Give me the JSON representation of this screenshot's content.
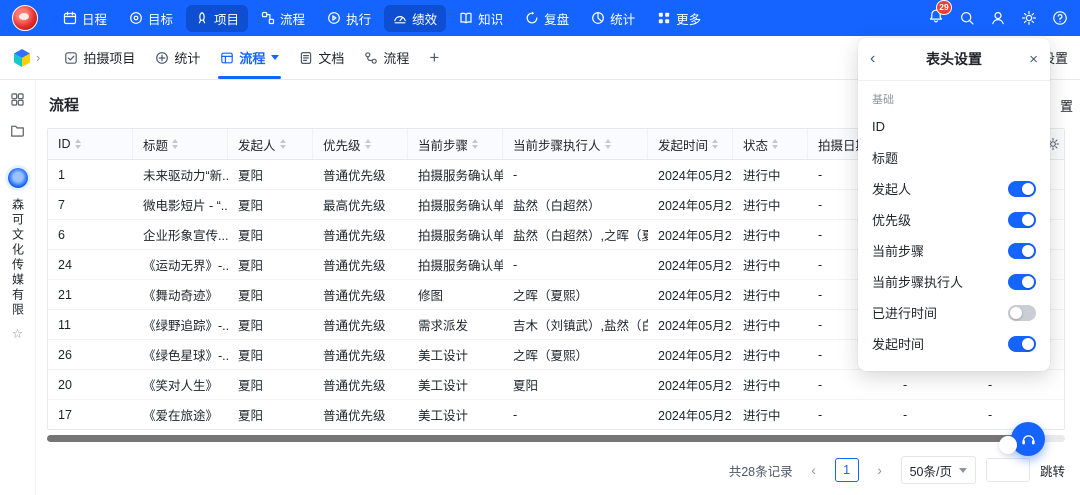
{
  "brand": {
    "accent_color": "#1664FF",
    "active_item_color": "#0E4FD1",
    "badge_color": "#F23C3C"
  },
  "topnav": {
    "items": [
      {
        "id": "schedule",
        "label": "日程",
        "icon": "calendar-icon",
        "active": false
      },
      {
        "id": "goals",
        "label": "目标",
        "icon": "target-icon",
        "active": false
      },
      {
        "id": "projects",
        "label": "项目",
        "icon": "project-icon",
        "active": true
      },
      {
        "id": "flow",
        "label": "流程",
        "icon": "flowchart-icon",
        "active": false
      },
      {
        "id": "execute",
        "label": "执行",
        "icon": "execute-icon",
        "active": false
      },
      {
        "id": "performance",
        "label": "绩效",
        "icon": "performance-icon",
        "active": true
      },
      {
        "id": "knowledge",
        "label": "知识",
        "icon": "knowledge-icon",
        "active": false
      },
      {
        "id": "review",
        "label": "复盘",
        "icon": "review-icon",
        "active": false
      },
      {
        "id": "stats",
        "label": "统计",
        "icon": "stats-icon",
        "active": false
      },
      {
        "id": "more",
        "label": "更多",
        "icon": "more-icon",
        "active": false
      }
    ],
    "notification_badge": "29"
  },
  "tabbar": {
    "tabs": [
      {
        "id": "shooting-project",
        "label": "拍摄项目",
        "icon": "check-square-icon",
        "active": false,
        "dropdown": false
      },
      {
        "id": "statistics",
        "label": "统计",
        "icon": "plus-circle-icon",
        "active": false,
        "dropdown": false
      },
      {
        "id": "flow",
        "label": "流程",
        "icon": "table-icon",
        "active": true,
        "dropdown": true
      },
      {
        "id": "docs",
        "label": "文档",
        "icon": "doc-icon",
        "active": false,
        "dropdown": false
      },
      {
        "id": "flow-2",
        "label": "流程",
        "icon": "workflow-icon",
        "active": false,
        "dropdown": false
      }
    ],
    "add_tab_label": "+",
    "right_label": "设置"
  },
  "sidebar": {
    "company_name": "森可文化传媒有限",
    "star_glyph": "☆"
  },
  "main": {
    "title": "流程",
    "toolbar_partial_label": "置",
    "table": {
      "columns": [
        {
          "label": "ID",
          "sortable": true
        },
        {
          "label": "标题",
          "sortable": true
        },
        {
          "label": "发起人",
          "sortable": true
        },
        {
          "label": "优先级",
          "sortable": true
        },
        {
          "label": "当前步骤",
          "sortable": true
        },
        {
          "label": "当前步骤执行人",
          "sortable": true
        },
        {
          "label": "发起时间",
          "sortable": true
        },
        {
          "label": "状态",
          "sortable": true
        },
        {
          "label": "拍摄日期",
          "sortable": true
        },
        {
          "label": "",
          "sortable": false
        },
        {
          "label": "",
          "sortable": false
        }
      ],
      "rows": [
        [
          "1",
          "未来驱动力“新...",
          "夏阳",
          "普通优先级",
          "拍摄服务确认单",
          "-",
          "2024年05月2...",
          "进行中",
          "-",
          "-",
          "-"
        ],
        [
          "7",
          "微电影短片 - “...",
          "夏阳",
          "最高优先级",
          "拍摄服务确认单",
          "盐然（白超然）",
          "2024年05月2...",
          "进行中",
          "-",
          "-",
          "-"
        ],
        [
          "6",
          "企业形象宣传...",
          "夏阳",
          "普通优先级",
          "拍摄服务确认单",
          "盐然（白超然）,之晖（夏熙）",
          "2024年05月2...",
          "进行中",
          "-",
          "-",
          "-"
        ],
        [
          "24",
          "《运动无界》-...",
          "夏阳",
          "普通优先级",
          "拍摄服务确认单",
          "-",
          "2024年05月2...",
          "进行中",
          "-",
          "-",
          "-"
        ],
        [
          "21",
          "《舞动奇迹》",
          "夏阳",
          "普通优先级",
          "修图",
          "之晖（夏熙）",
          "2024年05月2...",
          "进行中",
          "-",
          "-",
          "-"
        ],
        [
          "11",
          "《绿野追踪》-...",
          "夏阳",
          "普通优先级",
          "需求派发",
          "吉木（刘镇武）,盐然（白超然...",
          "2024年05月2...",
          "进行中",
          "-",
          "-",
          "-"
        ],
        [
          "26",
          "《绿色星球》-...",
          "夏阳",
          "普通优先级",
          "美工设计",
          "之晖（夏熙）",
          "2024年05月2...",
          "进行中",
          "-",
          "-",
          "-"
        ],
        [
          "20",
          "《笑对人生》",
          "夏阳",
          "普通优先级",
          "美工设计",
          "夏阳",
          "2024年05月2...",
          "进行中",
          "-",
          "-",
          "-"
        ],
        [
          "17",
          "《爱在旅途》",
          "夏阳",
          "普通优先级",
          "美工设计",
          "-",
          "2024年05月2...",
          "进行中",
          "-",
          "-",
          "-"
        ]
      ]
    },
    "pagination": {
      "total": "共28条记录",
      "prev": "‹",
      "page": "1",
      "next": "›",
      "page_size": "50条/页",
      "jump_input_value": "",
      "jump_label": "跳转"
    }
  },
  "header_settings_panel": {
    "title": "表头设置",
    "back_glyph": "‹",
    "close_glyph": "×",
    "section_label": "基础",
    "items": [
      {
        "label": "ID",
        "toggle": null
      },
      {
        "label": "标题",
        "toggle": null
      },
      {
        "label": "发起人",
        "toggle": "on"
      },
      {
        "label": "优先级",
        "toggle": "on"
      },
      {
        "label": "当前步骤",
        "toggle": "on"
      },
      {
        "label": "当前步骤执行人",
        "toggle": "on"
      },
      {
        "label": "已进行时间",
        "toggle": "off"
      },
      {
        "label": "发起时间",
        "toggle": "on"
      }
    ],
    "toggle_on_color": "#1664FF"
  }
}
